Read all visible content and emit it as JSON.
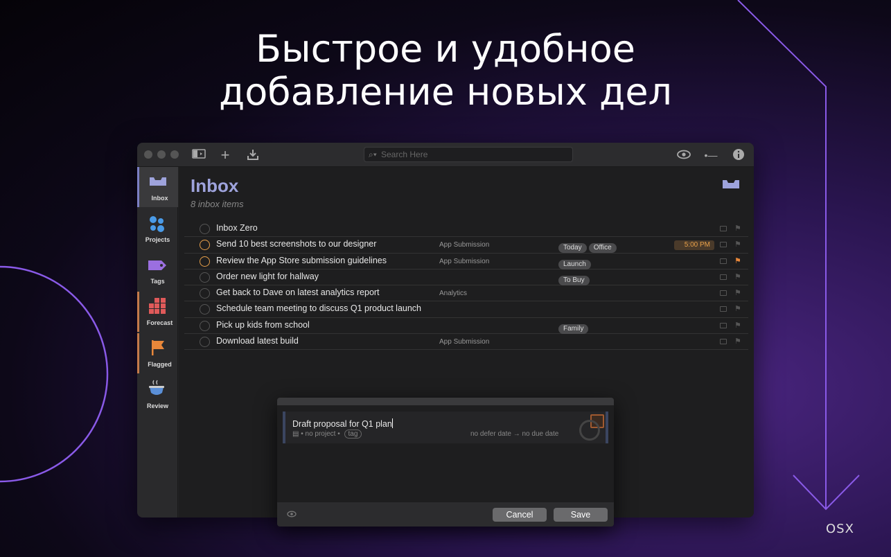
{
  "headline": {
    "line1": "Быстрое и удобное",
    "line2": "добавление новых дел"
  },
  "toolbar": {
    "search_placeholder": "Search Here",
    "icons": [
      "sidebar-toggle-icon",
      "plus-icon",
      "inbox-download-icon",
      "eye-icon",
      "dash-icon",
      "info-icon"
    ]
  },
  "sidebar": {
    "items": [
      {
        "label": "Inbox",
        "icon": "inbox-tray-icon",
        "color": "#9ea3dc"
      },
      {
        "label": "Projects",
        "icon": "projects-dots-icon",
        "color": "#4a9be8"
      },
      {
        "label": "Tags",
        "icon": "tag-icon",
        "color": "#9b6fe0"
      },
      {
        "label": "Forecast",
        "icon": "forecast-grid-icon",
        "color": "#e05a5a"
      },
      {
        "label": "Flagged",
        "icon": "flag-icon",
        "color": "#e8873a"
      },
      {
        "label": "Review",
        "icon": "coffee-cup-icon",
        "color": "#5a8fd8"
      }
    ]
  },
  "inbox": {
    "title": "Inbox",
    "subtitle": "8 inbox items"
  },
  "tasks": [
    {
      "title": "Inbox Zero",
      "project": "",
      "tags": [],
      "due": "",
      "flagged": false,
      "orange": false
    },
    {
      "title": "Send 10 best screenshots to our designer",
      "project": "App Submission",
      "tags": [
        "Today",
        "Office"
      ],
      "due": "5:00 PM",
      "flagged": false,
      "orange": true
    },
    {
      "title": "Review the App Store submission guidelines",
      "project": "App Submission",
      "tags": [
        "Launch"
      ],
      "due": "",
      "flagged": true,
      "orange": true
    },
    {
      "title": "Order new light for hallway",
      "project": "",
      "tags": [
        "To Buy"
      ],
      "due": "",
      "flagged": false,
      "orange": false
    },
    {
      "title": "Get back to Dave on latest analytics report",
      "project": "Analytics",
      "tags": [],
      "due": "",
      "flagged": false,
      "orange": false
    },
    {
      "title": "Schedule team meeting to discuss Q1 product launch",
      "project": "",
      "tags": [],
      "due": "",
      "flagged": false,
      "orange": false
    },
    {
      "title": "Pick up kids from school",
      "project": "",
      "tags": [
        "Family"
      ],
      "due": "",
      "flagged": false,
      "orange": false
    },
    {
      "title": "Download latest build",
      "project": "App Submission",
      "tags": [],
      "due": "",
      "flagged": false,
      "orange": false
    }
  ],
  "quick_entry": {
    "title": "Draft proposal for Q1 plan",
    "no_project": "no project",
    "tag_placeholder": "tag",
    "defer": "no defer date",
    "arrow": "→",
    "due": "no due date",
    "cancel_label": "Cancel",
    "save_label": "Save"
  },
  "watermark": "OSX"
}
